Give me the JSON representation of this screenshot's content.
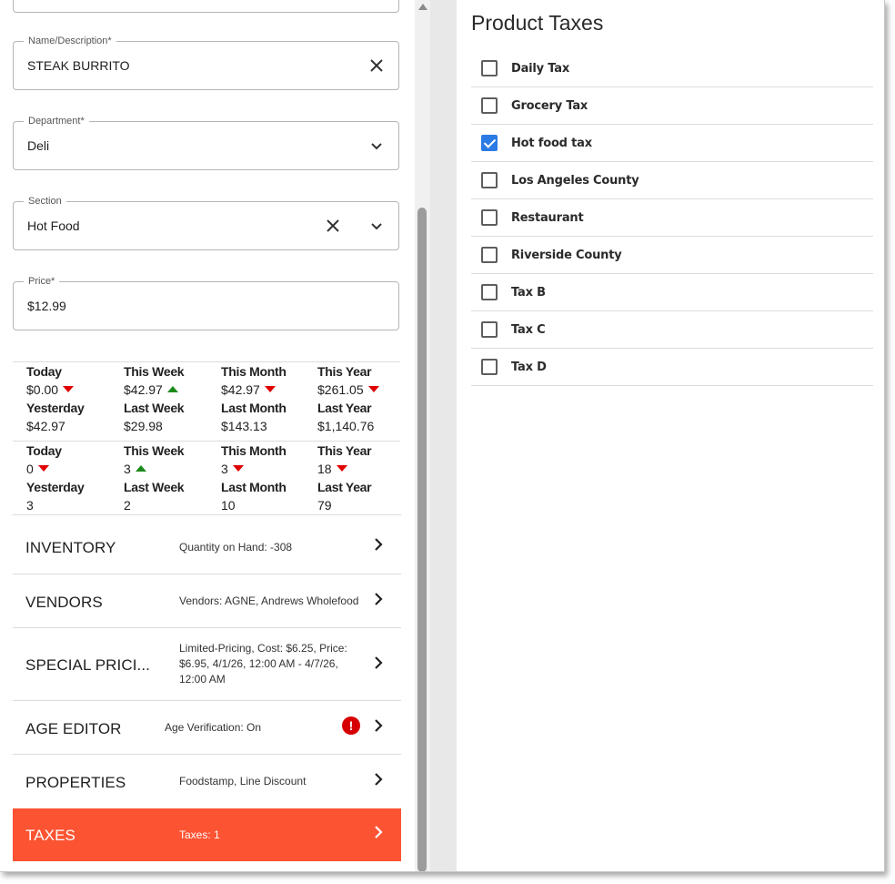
{
  "form": {
    "name": {
      "label": "Name/Description*",
      "value": "STEAK BURRITO"
    },
    "department": {
      "label": "Department*",
      "value": "Deli"
    },
    "section": {
      "label": "Section",
      "value": "Hot Food"
    },
    "price": {
      "label": "Price*",
      "value": "$12.99"
    }
  },
  "sales_amounts": [
    {
      "label": "Today",
      "value": "$0.00",
      "trend": "down"
    },
    {
      "label": "This Week",
      "value": "$42.97",
      "trend": "up"
    },
    {
      "label": "This Month",
      "value": "$42.97",
      "trend": "down"
    },
    {
      "label": "This Year",
      "value": "$261.05",
      "trend": "down"
    },
    {
      "label": "Yesterday",
      "value": "$42.97",
      "trend": ""
    },
    {
      "label": "Last Week",
      "value": "$29.98",
      "trend": ""
    },
    {
      "label": "Last Month",
      "value": "$143.13",
      "trend": ""
    },
    {
      "label": "Last Year",
      "value": "$1,140.76",
      "trend": ""
    }
  ],
  "sales_counts": [
    {
      "label": "Today",
      "value": "0",
      "trend": "down"
    },
    {
      "label": "This Week",
      "value": "3",
      "trend": "up"
    },
    {
      "label": "This Month",
      "value": "3",
      "trend": "down"
    },
    {
      "label": "This Year",
      "value": "18",
      "trend": "down"
    },
    {
      "label": "Yesterday",
      "value": "3",
      "trend": ""
    },
    {
      "label": "Last Week",
      "value": "2",
      "trend": ""
    },
    {
      "label": "Last Month",
      "value": "10",
      "trend": ""
    },
    {
      "label": "Last Year",
      "value": "79",
      "trend": ""
    }
  ],
  "sections": [
    {
      "title": "INVENTORY",
      "desc": "Quantity on Hand: -308"
    },
    {
      "title": "VENDORS",
      "desc": "Vendors: AGNE, Andrews Wholefood"
    },
    {
      "title": "SPECIAL PRICI...",
      "desc": "Limited-Pricing, Cost: $6.25, Price: $6.95, 4/1/26, 12:00 AM - 4/7/26, 12:00 AM"
    },
    {
      "title": "AGE EDITOR",
      "desc": "Age Verification: On",
      "alert": "!"
    },
    {
      "title": "PROPERTIES",
      "desc": "Foodstamp, Line Discount"
    },
    {
      "title": "TAXES",
      "desc": "Taxes: 1"
    }
  ],
  "product_taxes": {
    "title": "Product Taxes",
    "items": [
      {
        "label": "Daily Tax",
        "checked": false
      },
      {
        "label": "Grocery Tax",
        "checked": false
      },
      {
        "label": "Hot food tax",
        "checked": true
      },
      {
        "label": "Los Angeles County",
        "checked": false
      },
      {
        "label": "Restaurant",
        "checked": false
      },
      {
        "label": "Riverside County",
        "checked": false
      },
      {
        "label": "Tax B",
        "checked": false
      },
      {
        "label": "Tax C",
        "checked": false
      },
      {
        "label": "Tax D",
        "checked": false
      }
    ]
  },
  "colors": {
    "accent": "#fc5332",
    "checkbox": "#2c7be5",
    "trend_down": "#e00000",
    "trend_up": "#1a8a1a",
    "alert": "#d60000"
  },
  "icons": {
    "clear": "close-icon",
    "dropdown": "chevron-down-icon",
    "row": "chevron-right-icon",
    "alert": "exclamation-icon"
  }
}
